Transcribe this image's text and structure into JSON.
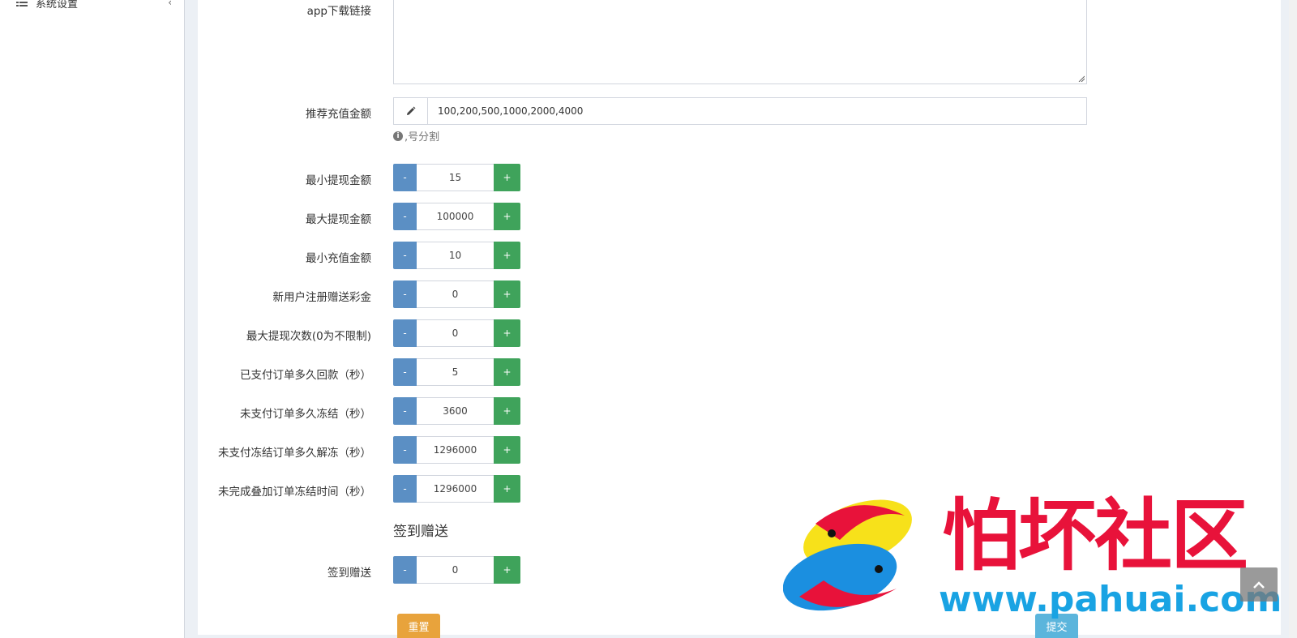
{
  "sidebar": {
    "item_label": "系统设置"
  },
  "form": {
    "app_link": {
      "label": "app下载链接",
      "value": ""
    },
    "recommend": {
      "label": "推荐充值金额",
      "value": "100,200,500,1000,2000,4000",
      "help": ",号分割"
    },
    "steppers": [
      {
        "label": "最小提现金额",
        "value": "15"
      },
      {
        "label": "最大提现金额",
        "value": "100000"
      },
      {
        "label": "最小充值金额",
        "value": "10"
      },
      {
        "label": "新用户注册赠送彩金",
        "value": "0"
      },
      {
        "label": "最大提现次数(0为不限制)",
        "value": "0"
      },
      {
        "label": "已支付订单多久回款（秒）",
        "value": "5"
      },
      {
        "label": "未支付订单多久冻结（秒）",
        "value": "3600"
      },
      {
        "label": "未支付冻结订单多久解冻（秒）",
        "value": "1296000"
      },
      {
        "label": "未完成叠加订单冻结时间（秒）",
        "value": "1296000"
      }
    ],
    "section_title": "签到赠送",
    "signin": {
      "label": "签到赠送",
      "value": "0"
    },
    "minus_label": "-",
    "plus_label": "+",
    "reset_label": "重置",
    "submit_label": "提交"
  },
  "watermark": {
    "text": "怕坏社区",
    "url": "www.pahuai.com"
  },
  "colors": {
    "minus": "#5b8fc4",
    "plus": "#3fa35b",
    "reset": "#e8a33c",
    "submit": "#5bb5dc"
  }
}
